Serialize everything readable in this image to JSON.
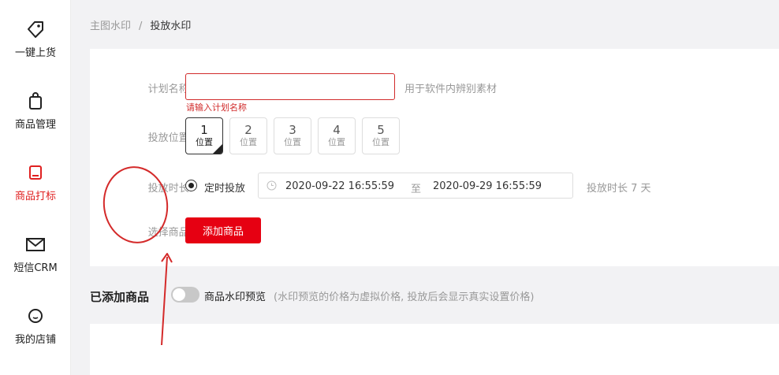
{
  "sidebar": {
    "items": [
      {
        "label": "一键上货",
        "icon": "tag-icon"
      },
      {
        "label": "商品管理",
        "icon": "shopping-bag-icon"
      },
      {
        "label": "商品打标",
        "icon": "label-icon",
        "active": true
      },
      {
        "label": "短信CRM",
        "icon": "envelope-icon"
      },
      {
        "label": "我的店铺",
        "icon": "smile-icon"
      }
    ]
  },
  "breadcrumb": {
    "parent": "主图水印",
    "separator": "/",
    "current": "投放水印"
  },
  "form": {
    "name_label": "计划名称:",
    "name_value": "",
    "name_hint": "用于软件内辨别素材",
    "name_error": "请输入计划名称",
    "position_label": "投放位置:",
    "positions": [
      {
        "num": "1",
        "sub": "位置",
        "selected": true
      },
      {
        "num": "2",
        "sub": "位置"
      },
      {
        "num": "3",
        "sub": "位置"
      },
      {
        "num": "4",
        "sub": "位置"
      },
      {
        "num": "5",
        "sub": "位置"
      }
    ],
    "duration_label": "投放时长:",
    "timed_option": "定时投放",
    "start_date": "2020-09-22 16:55:59",
    "range_sep": "至",
    "end_date": "2020-09-29 16:55:59",
    "duration_text": "投放时长 7 天",
    "product_label": "选择商品:",
    "add_product_button": "添加商品"
  },
  "added": {
    "title": "已添加商品",
    "preview_label": "商品水印预览",
    "preview_note": "(水印预览的价格为虚拟价格, 投放后会显示真实设置价格)"
  },
  "colors": {
    "accent": "#e60012",
    "error": "#d12b2b",
    "annotation": "#d42a2a"
  }
}
